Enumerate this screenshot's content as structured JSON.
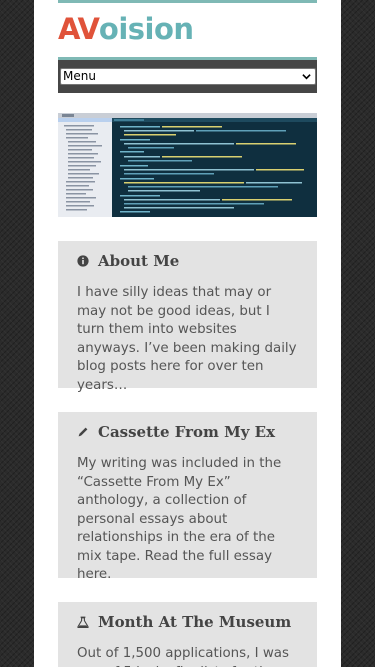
{
  "site": {
    "logo_prefix": "AV",
    "logo_suffix": "oision",
    "brand_colors": {
      "prefix": "#e0533a",
      "suffix": "#66b2b5",
      "rule": "#7fb9b5"
    }
  },
  "nav": {
    "menu_label": "Menu"
  },
  "widgets": [
    {
      "icon": "info-icon",
      "title": "About Me",
      "body": "I have silly ideas that may or may not be good ideas, but I turn them into websites anyways. I’ve been making daily blog posts here for over ten years…"
    },
    {
      "icon": "pencil-icon",
      "title": "Cassette From My Ex",
      "body": "My writing was included in the “Cassette From My Ex” anthology, a collection of personal essays about relationships in the era of the mix tape. Read the full essay here."
    },
    {
      "icon": "flask-icon",
      "title": "Month At The Museum",
      "body": "Out of 1,500 applications, I was one of 5 lucky finalists for the"
    }
  ]
}
